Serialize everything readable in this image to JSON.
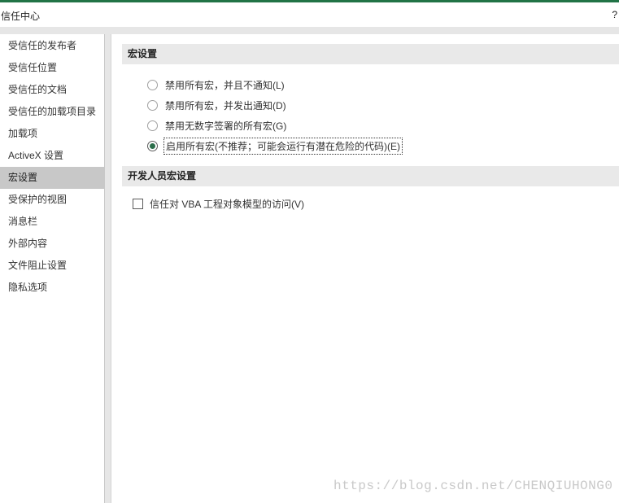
{
  "window": {
    "title": "信任中心",
    "help_label": "?"
  },
  "sidebar": {
    "items": [
      {
        "label": "受信任的发布者",
        "selected": false
      },
      {
        "label": "受信任位置",
        "selected": false
      },
      {
        "label": "受信任的文档",
        "selected": false
      },
      {
        "label": "受信任的加载项目录",
        "selected": false
      },
      {
        "label": "加载项",
        "selected": false
      },
      {
        "label": "ActiveX 设置",
        "selected": false
      },
      {
        "label": "宏设置",
        "selected": true
      },
      {
        "label": "受保护的视图",
        "selected": false
      },
      {
        "label": "消息栏",
        "selected": false
      },
      {
        "label": "外部内容",
        "selected": false
      },
      {
        "label": "文件阻止设置",
        "selected": false
      },
      {
        "label": "隐私选项",
        "selected": false
      }
    ]
  },
  "macro_settings": {
    "header": "宏设置",
    "options": [
      {
        "label": "禁用所有宏，并且不通知(L)",
        "checked": false
      },
      {
        "label": "禁用所有宏，并发出通知(D)",
        "checked": false
      },
      {
        "label": "禁用无数字签署的所有宏(G)",
        "checked": false
      },
      {
        "label": "启用所有宏(不推荐；可能会运行有潜在危险的代码)(E)",
        "checked": true
      }
    ]
  },
  "developer_settings": {
    "header": "开发人员宏设置",
    "vba_trust_label": "信任对 VBA 工程对象模型的访问(V)",
    "vba_trust_checked": false
  },
  "watermark": "https://blog.csdn.net/CHENQIUHONG0",
  "colors": {
    "accent": "#217346",
    "selected_item": "#c8c8c8",
    "section_header": "#e9e9e9",
    "radio_dot": "#2b6e4a"
  }
}
